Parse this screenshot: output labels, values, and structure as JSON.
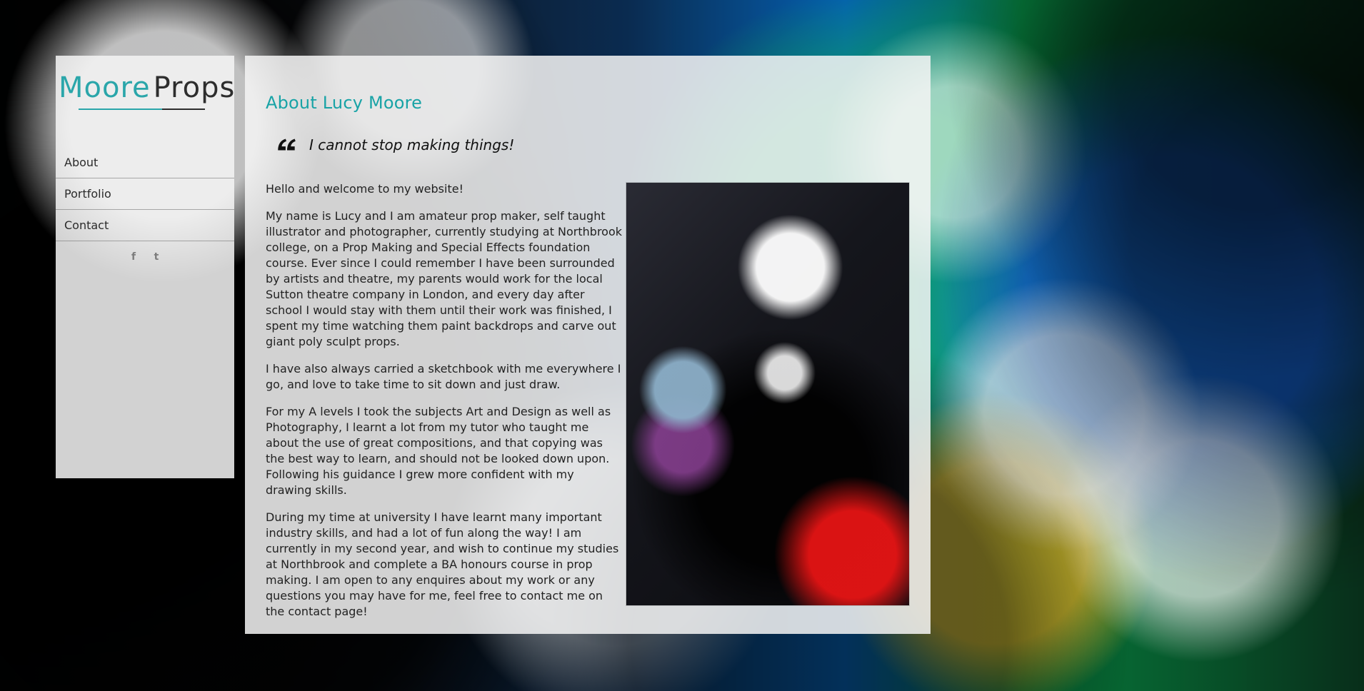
{
  "background": {
    "name": "painted-flowers-background"
  },
  "brand": {
    "moore": "Moore",
    "props": "Props",
    "accent": "#18a3a6"
  },
  "nav": {
    "items": [
      {
        "label": "About"
      },
      {
        "label": "Portfolio"
      },
      {
        "label": "Contact"
      }
    ]
  },
  "social": {
    "facebook_glyph": "f",
    "twitter_glyph": "t"
  },
  "page": {
    "title": "About Lucy Moore",
    "quote": "I cannot stop making things!",
    "paragraphs": [
      "Hello and welcome to my website!",
      "My name is Lucy and I am amateur prop maker, self taught illustrator and photographer, currently studying at Northbrook college, on a Prop Making and Special Effects foundation course. Ever since I could remember I have been surrounded by artists and theatre, my parents would work for the local Sutton theatre company in London, and every day after school I would stay with them until their work was finished, I spent my time watching them paint backdrops and carve out giant poly sculpt props.",
      "I have also always carried a sketchbook with me everywhere I go, and love to take time to sit down and just draw.",
      "For my A levels I took the subjects Art and Design as well as Photography, I learnt a lot from my tutor who taught me about the use of great compositions, and that copying was the best way to learn, and should not be looked down upon. Following his guidance I grew more confident with my drawing skills.",
      "During my time at university I have learnt many important industry skills, and had a lot of fun along the way! I am currently in my second year, and wish to continue my studies at Northbrook and complete a BA honours course in prop making. I am open to any enquires about my work or any questions you may have for me, feel free to contact me on the contact page!"
    ]
  }
}
